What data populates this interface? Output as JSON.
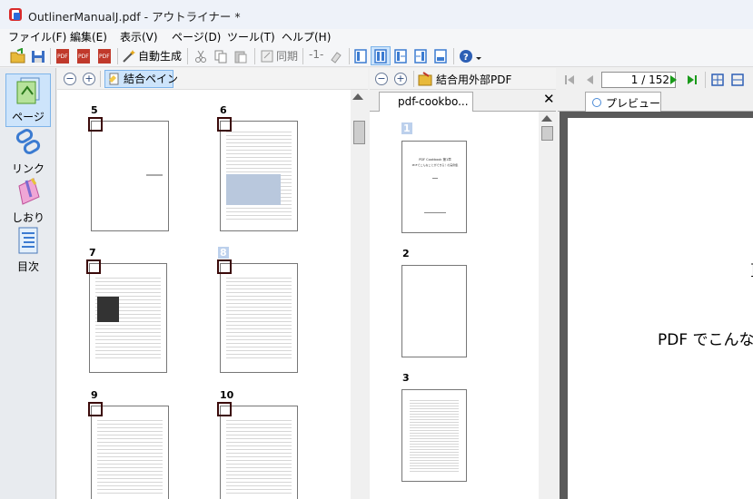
{
  "window": {
    "title": "OutlinerManualJ.pdf - アウトライナー *"
  },
  "menu": [
    "ファイル(F)",
    "編集(E)",
    "表示(V)",
    "ページ(D)",
    "ツール(T)",
    "ヘルプ(H)"
  ],
  "toolbar": {
    "auto_generate": "自動生成",
    "sync": "同期",
    "page_label": "-1-"
  },
  "left_nav": [
    {
      "label": "ページ",
      "icon": "page-icon"
    },
    {
      "label": "リンク",
      "icon": "link-icon"
    },
    {
      "label": "しおり",
      "icon": "bookmark-icon"
    },
    {
      "label": "目次",
      "icon": "toc-icon"
    }
  ],
  "pages_pane": {
    "combine_pane_label": "結合ペイン",
    "pages": [
      {
        "num": "5",
        "selected": false
      },
      {
        "num": "6",
        "selected": false
      },
      {
        "num": "7",
        "selected": false
      },
      {
        "num": "8",
        "selected": true
      },
      {
        "num": "9",
        "selected": false
      },
      {
        "num": "10",
        "selected": false
      }
    ]
  },
  "external_pane": {
    "header_label": "結合用外部PDF",
    "tab_label": "pdf-cookbo...",
    "pages": [
      {
        "num": "1",
        "title": "PDF Cookbook 第1章",
        "subtitle": "PDFでこんなことができる！の実例集"
      },
      {
        "num": "2"
      },
      {
        "num": "3"
      }
    ]
  },
  "preview_pane": {
    "page_indicator": "1 / 152",
    "tab_label": "プレビュー",
    "preview_text": "PDF でこんな",
    "preview_text_top": "I"
  },
  "colors": {
    "accent": "#cde4fb",
    "marker": "#3b0a0a",
    "selected_num": "#bcd0ec"
  }
}
